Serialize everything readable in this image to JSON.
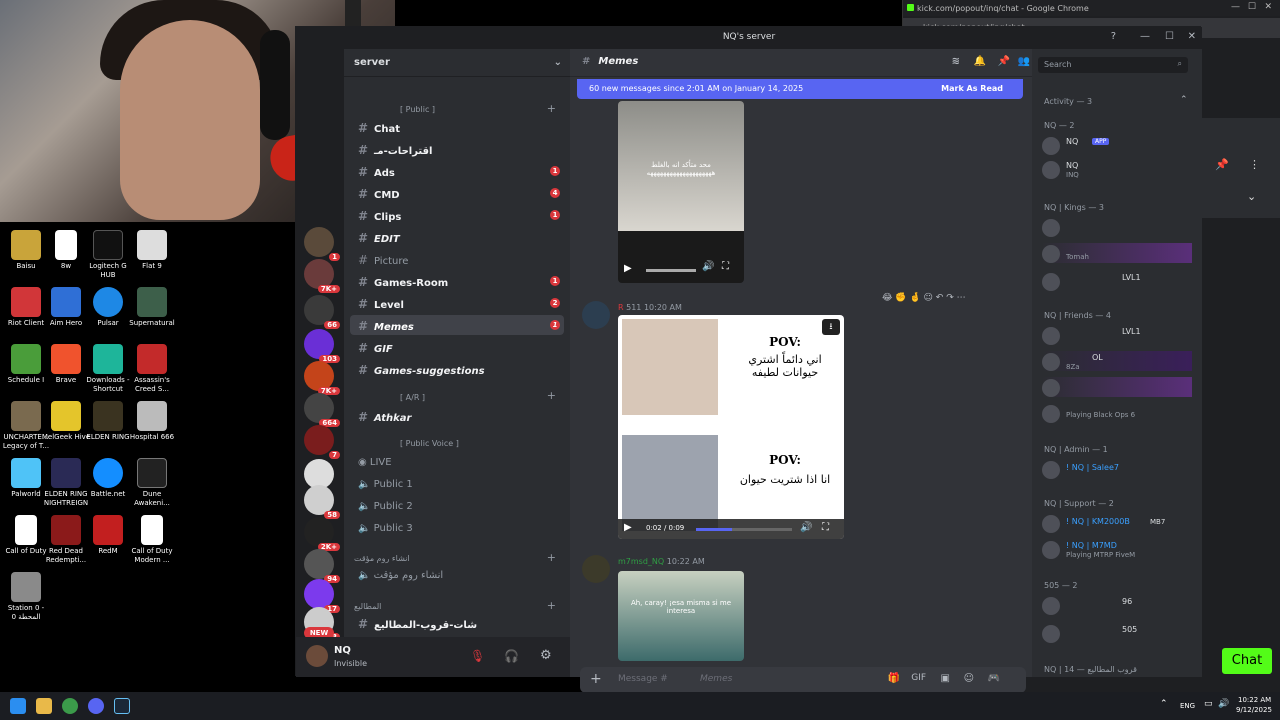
{
  "desktop": {
    "icons": [
      {
        "label": "Baisu"
      },
      {
        "label": "8w"
      },
      {
        "label": "Logitech G HUB"
      },
      {
        "label": "Flat 9"
      },
      {
        "label": "Riot Client"
      },
      {
        "label": "Aim Hero"
      },
      {
        "label": "Pulsar"
      },
      {
        "label": "Supernatural"
      },
      {
        "label": "Schedule I"
      },
      {
        "label": "Brave"
      },
      {
        "label": "Downloads - Shortcut"
      },
      {
        "label": "Assassin's Creed S..."
      },
      {
        "label": "UNCHARTE... Legacy of T..."
      },
      {
        "label": "MelGeek Hive"
      },
      {
        "label": "ELDEN RING"
      },
      {
        "label": "Hospital 666"
      },
      {
        "label": "Palworld"
      },
      {
        "label": "ELDEN RING NIGHTREIGN"
      },
      {
        "label": "Battle.net"
      },
      {
        "label": "Dune Awakeni..."
      },
      {
        "label": "Call of Duty"
      },
      {
        "label": "Red Dead Redempti..."
      },
      {
        "label": "RedM"
      },
      {
        "label": "Call of Duty Modern ..."
      },
      {
        "label": "Station 0 - المحطة 0"
      }
    ]
  },
  "chrome": {
    "title": "kick.com/popout/inq/chat - Google Chrome",
    "url": "kick.com/popout/inq/chat",
    "chat_button": "Chat"
  },
  "discord": {
    "window_title": "NQ's server",
    "server_name": "server",
    "categories": {
      "public": "[ Public ]",
      "ajr": "[ A/R ]",
      "public_voice": "[ Public Voice ]",
      "create_room": "انشاء روم مؤقت",
      "last": "المطاليع"
    },
    "channels": [
      {
        "label": "Chat",
        "badge": ""
      },
      {
        "label": "اقتراحات-مـ",
        "badge": ""
      },
      {
        "label": "Ads",
        "badge": "1"
      },
      {
        "label": "CMD",
        "badge": "4"
      },
      {
        "label": "Clips",
        "badge": "1"
      },
      {
        "label": "EDIT",
        "badge": ""
      },
      {
        "label": "Picture",
        "badge": ""
      },
      {
        "label": "Games-Room",
        "badge": "1"
      },
      {
        "label": "Level",
        "badge": "2"
      },
      {
        "label": "Memes",
        "badge": "1"
      },
      {
        "label": "GIF",
        "badge": ""
      },
      {
        "label": "Games-suggestions",
        "badge": ""
      },
      {
        "label": "Athkar",
        "badge": ""
      }
    ],
    "voice_channels": [
      "LIVE",
      "Public 1",
      "Public 2",
      "Public 3",
      "انشاء روم مؤقت"
    ],
    "last_channel": "شات-قروب-المطاليع",
    "guild_badges": [
      "1",
      "7K+",
      "66",
      "103",
      "7K+",
      "664",
      "7",
      "58",
      "2K+",
      "94",
      "17",
      "3"
    ],
    "user": {
      "name": "NQ",
      "status": "Invisible",
      "new_label": "NEW"
    },
    "main": {
      "channel_name": "Memes",
      "banner_text": "60 new messages since 2:01 AM on January 14, 2025",
      "mark_as_read": "Mark As Read",
      "video1_caption": "محد متأكد انه بالغلط ههههههههههههههههههههه",
      "msg2_badge": "511",
      "msg2_time": "10:20 AM",
      "pov1_title": "POV:",
      "pov1_text": "اني دائماً اشتري حيوانات لطيفه",
      "pov2_title": "POV:",
      "pov2_text": "انا اذا شتريت حيوان",
      "video2_time": "0:02 / 0:09",
      "msg3_author": "m7msd_NQ",
      "msg3_time": "10:22 AM",
      "video3_caption": "Ah, caray! ¡esa misma si me interesa",
      "composer_placeholder": "Message #",
      "composer_channel": "Memes"
    },
    "members": {
      "search_placeholder": "Search",
      "activity": "Activity — 3",
      "groups": [
        {
          "head": "NQ — 2",
          "items": [
            {
              "name": "NQ",
              "sub": "APP"
            },
            {
              "name": "NQ",
              "sub": "INQ"
            }
          ]
        },
        {
          "head": "NQ | Kings — 3",
          "items": [
            {
              "name": "",
              "sub": ""
            },
            {
              "name": "",
              "sub": "Tomah"
            },
            {
              "name": "",
              "sub": "LVL1"
            }
          ]
        },
        {
          "head": "NQ | Friends — 4",
          "items": [
            {
              "name": "",
              "sub": "LVL1"
            },
            {
              "name": "OL",
              "sub": "8Za"
            },
            {
              "name": "",
              "sub": ""
            },
            {
              "name": "",
              "sub": "Playing Black Ops 6"
            }
          ]
        },
        {
          "head": "NQ | Admin — 1",
          "items": [
            {
              "name": "! NQ | Salee7",
              "sub": ""
            }
          ]
        },
        {
          "head": "NQ | Support — 2",
          "items": [
            {
              "name": "! NQ | KM2000B",
              "sub": "MB7"
            },
            {
              "name": "! NQ | M7MD",
              "sub": "Playing MTRP FiveM"
            }
          ]
        },
        {
          "head": "505 — 2",
          "items": [
            {
              "name": "",
              "sub": "96"
            },
            {
              "name": "",
              "sub": "505"
            }
          ]
        },
        {
          "head": "NQ | 14 — قروب المطاليع",
          "items": []
        }
      ]
    }
  },
  "taskbar": {
    "lang": "ENG",
    "time": "10:22 AM",
    "date": "9/12/2025"
  },
  "colors": {
    "blurple": "#5865f2",
    "kick_green": "#53fc18",
    "red_badge": "#da373c"
  }
}
